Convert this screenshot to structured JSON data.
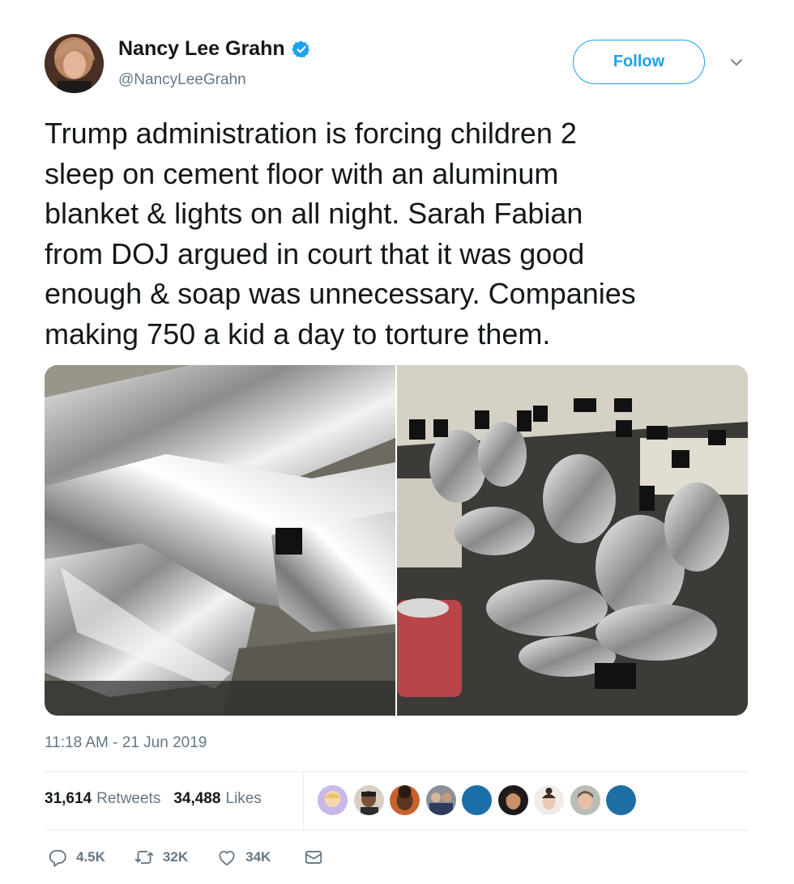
{
  "tweet": {
    "author_name": "Nancy Lee Grahn",
    "author_handle": "@NancyLeeGrahn",
    "verified": true,
    "follow_label": "Follow",
    "text": "Trump administration is forcing children 2\nsleep on cement floor with an aluminum\nblanket & lights on all night. Sarah Fabian\nfrom DOJ argued in court that it was good\nenough & soap was unnecessary. Companies\nmaking 750 a kid a day to torture them.",
    "timestamp": "11:18 AM - 21 Jun 2019",
    "retweets_count": "31,614",
    "retweets_label": "Retweets",
    "likes_count": "34,488",
    "likes_label": "Likes",
    "reply_count": "4.5K",
    "retweet_action_count": "32K",
    "like_action_count": "34K"
  },
  "icons": {
    "verified": "verified-badge-icon",
    "caret": "chevron-down-icon",
    "reply": "reply-icon",
    "retweet": "retweet-icon",
    "like": "heart-icon",
    "dm": "envelope-icon"
  },
  "colors": {
    "accent": "#1da1f2",
    "text": "#14171a",
    "secondary_text": "#657786",
    "divider": "#e6ecf0"
  }
}
